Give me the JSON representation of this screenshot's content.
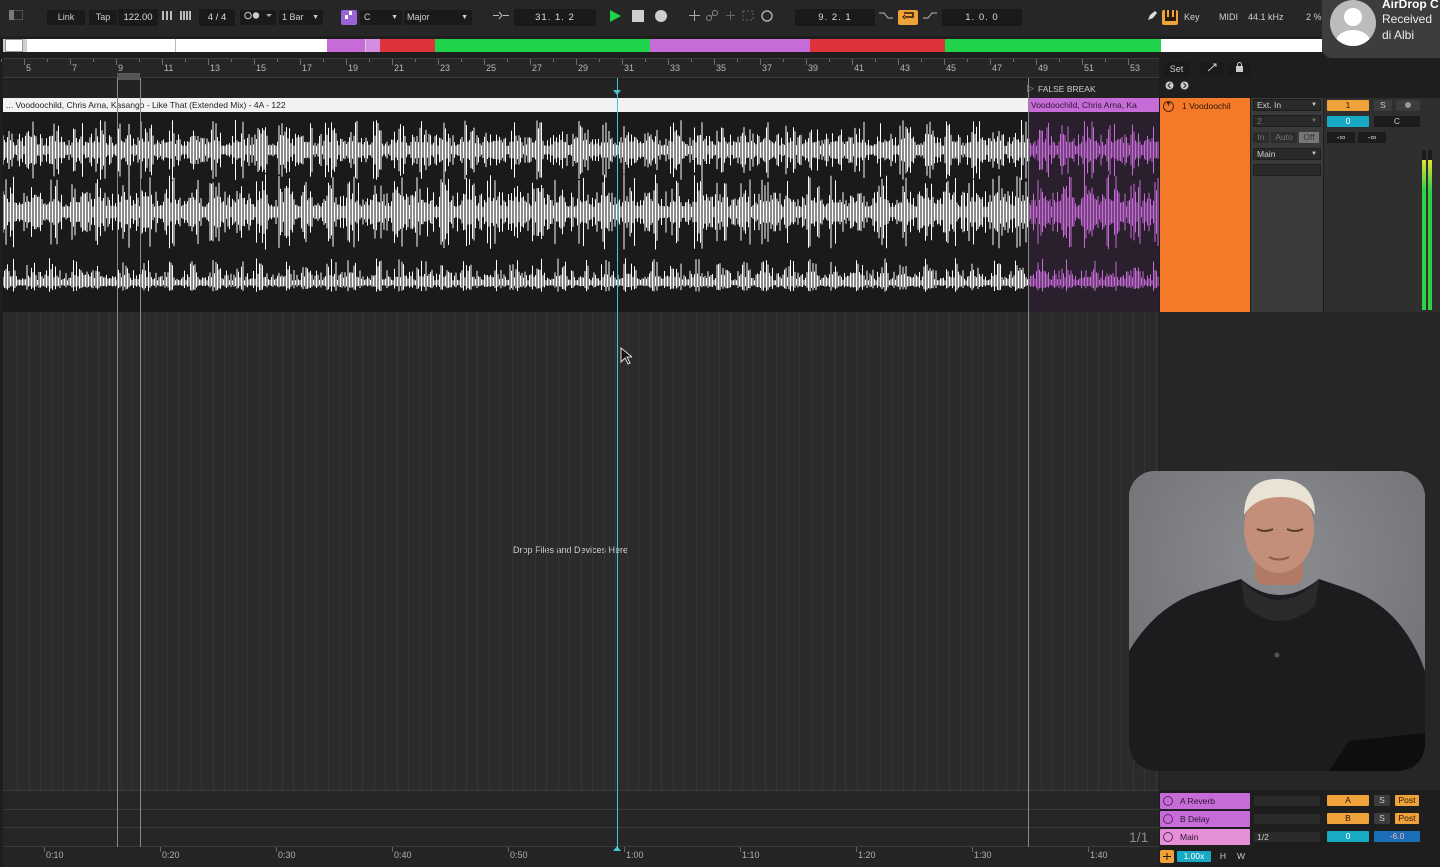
{
  "toolbar": {
    "link_label": "Link",
    "tap_label": "Tap",
    "tempo": "122.00",
    "time_signature": "4 / 4",
    "quantize": "1 Bar",
    "key_root": "C",
    "scale": "Major",
    "arrangement_position": "31.  1.  2",
    "loop_start": "9.  2.  1",
    "loop_length": "1.  0.  0",
    "key_label": "Key",
    "midi_label": "MIDI",
    "sample_rate": "44.1 kHz",
    "cpu": "2 %"
  },
  "colors": {
    "accent_orange": "#f47a2a",
    "clip_purple": "#c66bd8",
    "section_green": "#1fd34a",
    "section_red": "#e0323a",
    "play_green": "#1fd34a"
  },
  "ruler": {
    "bars": [
      "5",
      "7",
      "9",
      "11",
      "13",
      "15",
      "17",
      "19",
      "21",
      "23",
      "25",
      "27",
      "29",
      "31",
      "33",
      "35",
      "37",
      "39",
      "41",
      "43",
      "45",
      "47",
      "49",
      "51",
      "53"
    ]
  },
  "locator": {
    "label": "FALSE BREAK"
  },
  "clip": {
    "name": "... Voodoochild, Chris Arna, Kasango - Like That (Extended Mix) - 4A - 122",
    "name_2": "Voodoochild, Chris Arna, Ka"
  },
  "arrangement": {
    "drop_hint": "Drop Files and Devices Here",
    "zoom_label": "1/1"
  },
  "track": {
    "title": "1 Voodoochil",
    "input_type": "Ext. In",
    "input_channel": "2",
    "monitor_in": "In",
    "monitor_auto": "Auto",
    "monitor_off": "Off",
    "output": "Main",
    "number": "1",
    "solo": "S",
    "volume": "0",
    "pan": "C",
    "peak_left": "-∞",
    "peak_right": "-∞",
    "set_label": "Set"
  },
  "returns": [
    {
      "name": "A Reverb",
      "letter": "A",
      "solo": "S",
      "post": "Post"
    },
    {
      "name": "B Delay",
      "letter": "B",
      "solo": "S",
      "post": "Post"
    },
    {
      "name": "Main",
      "letter": "1/2",
      "solo": "0",
      "post": "-6.0"
    }
  ],
  "time_ruler": {
    "marks": [
      "0:10",
      "0:20",
      "0:30",
      "0:40",
      "0:50",
      "1:00",
      "1:10",
      "1:20",
      "1:30",
      "1:40"
    ]
  },
  "footer": {
    "zoom": "1.00x",
    "h_label": "H",
    "w_label": "W"
  },
  "airdrop": {
    "line1": "AirDrop C",
    "line2": "Received",
    "line3": "di Albi"
  }
}
